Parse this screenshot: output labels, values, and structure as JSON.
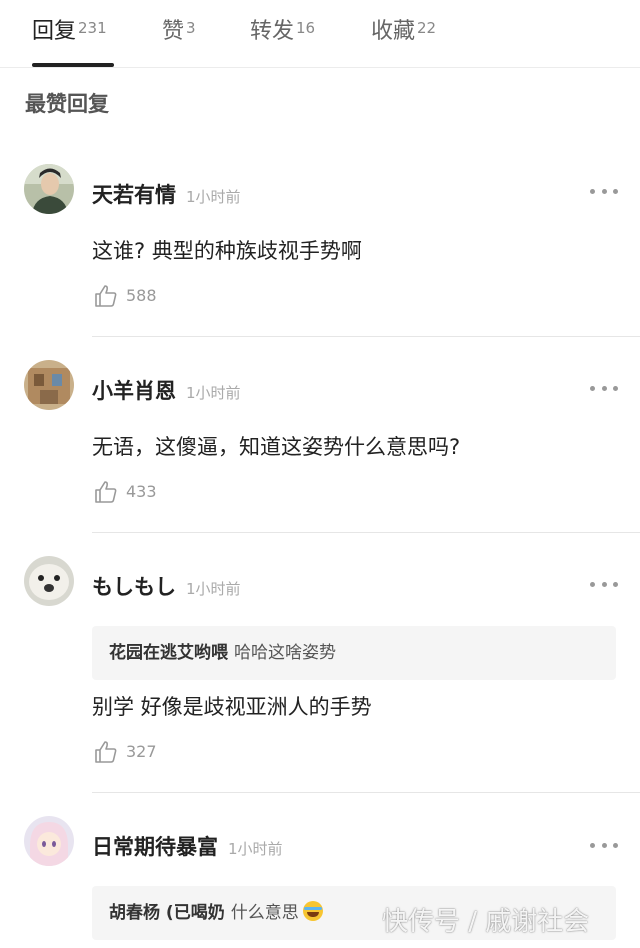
{
  "tabs": [
    {
      "label": "回复",
      "count": "231"
    },
    {
      "label": "赞",
      "count": "3"
    },
    {
      "label": "转发",
      "count": "16"
    },
    {
      "label": "收藏",
      "count": "22"
    }
  ],
  "section_title": "最赞回复",
  "comments": [
    {
      "username": "天若有情",
      "time": "1小时前",
      "text": "这谁? 典型的种族歧视手势啊",
      "likes": "588"
    },
    {
      "username": "小羊肖恩",
      "time": "1小时前",
      "text": "无语，这傻逼，知道这姿势什么意思吗?",
      "likes": "433"
    },
    {
      "username": "もしもし",
      "time": "1小时前",
      "quote_user": "花园在逃艾哟喂",
      "quote_text": "哈哈这啥姿势",
      "text": "别学 好像是歧视亚洲人的手势",
      "likes": "327"
    },
    {
      "username": "日常期待暴富",
      "time": "1小时前",
      "quote_user": "胡春杨 (已喝奶",
      "quote_text": "什么意思"
    }
  ],
  "watermark": "快传号 / 戚谢社会",
  "colors": {
    "background": "#ffffff",
    "active_underline": "#222222",
    "quote_bg": "#f5f5f5"
  },
  "icons": [
    "more-icon",
    "thumbs-up-icon",
    "tears-of-joy-emoji"
  ]
}
